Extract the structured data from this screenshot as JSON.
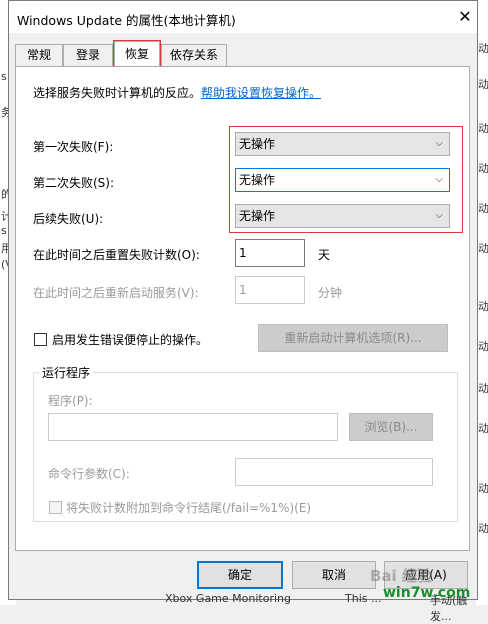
{
  "window": {
    "title": "Windows Update 的属性(本地计算机)",
    "close_glyph": "✕"
  },
  "tabs": [
    {
      "label": "常规"
    },
    {
      "label": "登录"
    },
    {
      "label": "恢复"
    },
    {
      "label": "依存关系"
    }
  ],
  "recovery": {
    "intro": "选择服务失败时计算机的反应。",
    "help_link": "帮助我设置恢复操作。",
    "first_failure": {
      "label": "第一次失败(F):",
      "value": "无操作"
    },
    "second_failure": {
      "label": "第二次失败(S):",
      "value": "无操作"
    },
    "subsequent_failure": {
      "label": "后续失败(U):",
      "value": "无操作"
    },
    "reset_count": {
      "label": "在此时间之后重置失败计数(O):",
      "value": "1",
      "unit": "天"
    },
    "restart_service": {
      "label": "在此时间之后重新启动服务(V):",
      "value": "1",
      "unit": "分钟"
    },
    "stop_with_errors": {
      "label": "启用发生错误便停止的操作。",
      "checked": false
    },
    "restart_options_button": "重新启动计算机选项(R)...",
    "run_program": {
      "group_title": "运行程序",
      "program_label": "程序(P):",
      "browse_button": "浏览(B)...",
      "cmd_label": "命令行参数(C):",
      "append_label": "将失败计数附加到命令行结尾(/fail=%1%)(E)"
    }
  },
  "buttons": {
    "ok": "确定",
    "cancel": "取消",
    "apply": "应用(A)"
  },
  "background": {
    "bottom_item": "Xbox Game Monitoring",
    "bottom_item2": "This ...",
    "bottom_item3": "手动(触发...",
    "left_fragments": [
      "s",
      "务",
      "的",
      "计",
      "s",
      "用",
      "(V"
    ],
    "right_fragments": [
      "动",
      "动",
      "动",
      "动",
      "动",
      "动",
      "动",
      "动",
      "动",
      "动",
      "动",
      "动"
    ]
  },
  "watermark": {
    "brand": "Bai 经验",
    "site": "win7w.com"
  },
  "icons": {
    "chevron": "chevron-down-icon",
    "close": "close-icon"
  },
  "colors": {
    "accent": "#0078d7",
    "highlight_red": "#d83b3b",
    "link": "#0066cc"
  }
}
